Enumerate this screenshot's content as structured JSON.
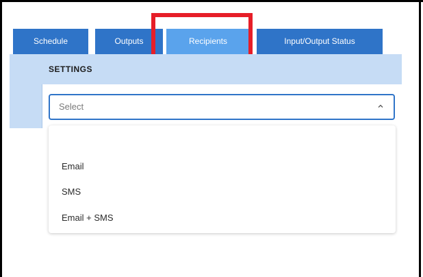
{
  "tabs": [
    {
      "label": "Schedule"
    },
    {
      "label": "Outputs"
    },
    {
      "label": "Recipients",
      "active": true
    },
    {
      "label": "Input/Output Status"
    }
  ],
  "settings": {
    "title": "SETTINGS"
  },
  "select": {
    "placeholder": "Select",
    "expanded": true,
    "options": [
      "Email",
      "SMS",
      "Email + SMS"
    ]
  },
  "icons": {
    "select_chevron": "chevron-up-icon"
  },
  "colors": {
    "tab_background": "#2f74c8",
    "tab_active": "#5aa3ec",
    "settings_bar": "#c6dcf5",
    "highlight": "#e61e28",
    "select_border": "#2f74c8"
  }
}
